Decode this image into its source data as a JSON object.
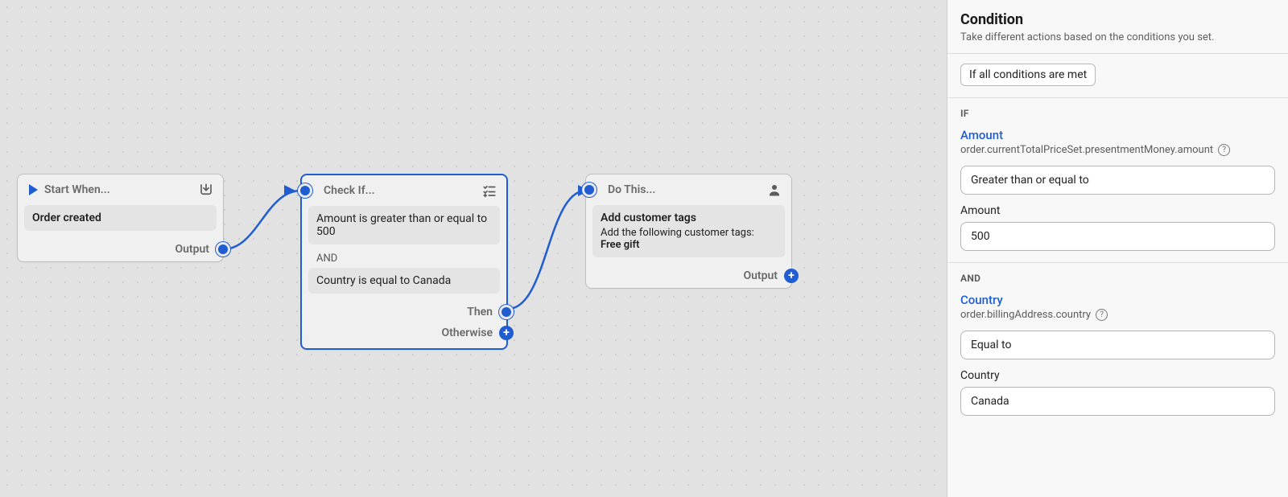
{
  "canvas": {
    "start_node": {
      "header": "Start When...",
      "trigger": "Order created",
      "output_label": "Output"
    },
    "condition_node": {
      "header": "Check If...",
      "cond1": "Amount is greater than or equal to 500",
      "joiner": "AND",
      "cond2": "Country is equal to Canada",
      "then_label": "Then",
      "otherwise_label": "Otherwise"
    },
    "action_node": {
      "header": "Do This...",
      "action_title": "Add customer tags",
      "action_desc": "Add the following customer tags:",
      "action_tag": "Free gift",
      "output_label": "Output"
    }
  },
  "sidebar": {
    "title": "Condition",
    "subtitle": "Take different actions based on the conditions you set.",
    "match_mode": "If all conditions are met",
    "if_label": "If",
    "and_label": "And",
    "field1": {
      "name": "Amount",
      "path": "order.currentTotalPriceSet.presentmentMoney.amount",
      "operator": "Greater than or equal to",
      "value_label": "Amount",
      "value": "500"
    },
    "field2": {
      "name": "Country",
      "path": "order.billingAddress.country",
      "operator": "Equal to",
      "value_label": "Country",
      "value": "Canada"
    }
  }
}
